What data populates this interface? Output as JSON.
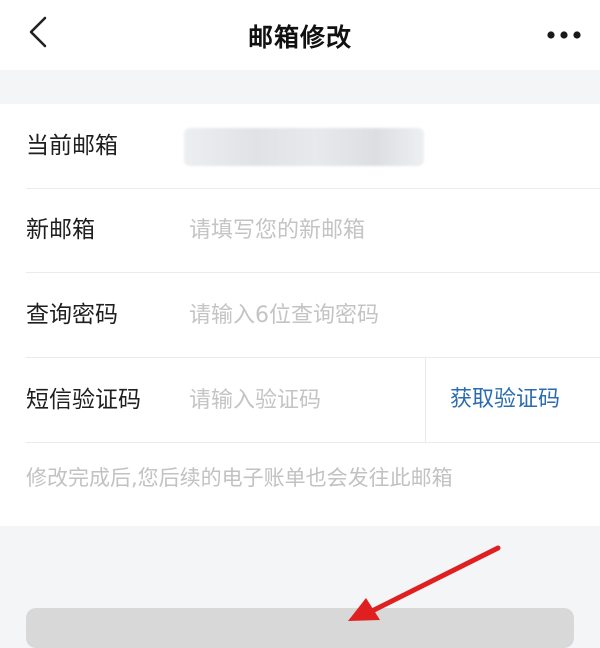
{
  "header": {
    "back_icon": "chevron-left-icon",
    "title": "邮箱修改",
    "more_icon": "more-horizontal-icon"
  },
  "form": {
    "current_email": {
      "label": "当前邮箱",
      "value_hidden": true
    },
    "new_email": {
      "label": "新邮箱",
      "placeholder": "请填写您的新邮箱"
    },
    "query_password": {
      "label": "查询密码",
      "placeholder": "请输入6位查询密码"
    },
    "sms_code": {
      "label": "短信验证码",
      "placeholder": "请输入验证码",
      "get_code_label": "获取验证码"
    },
    "note": "修改完成后,您后续的电子账单也会发往此邮箱"
  },
  "colors": {
    "link": "#2b6cb0",
    "annotation_arrow": "#e02020"
  }
}
